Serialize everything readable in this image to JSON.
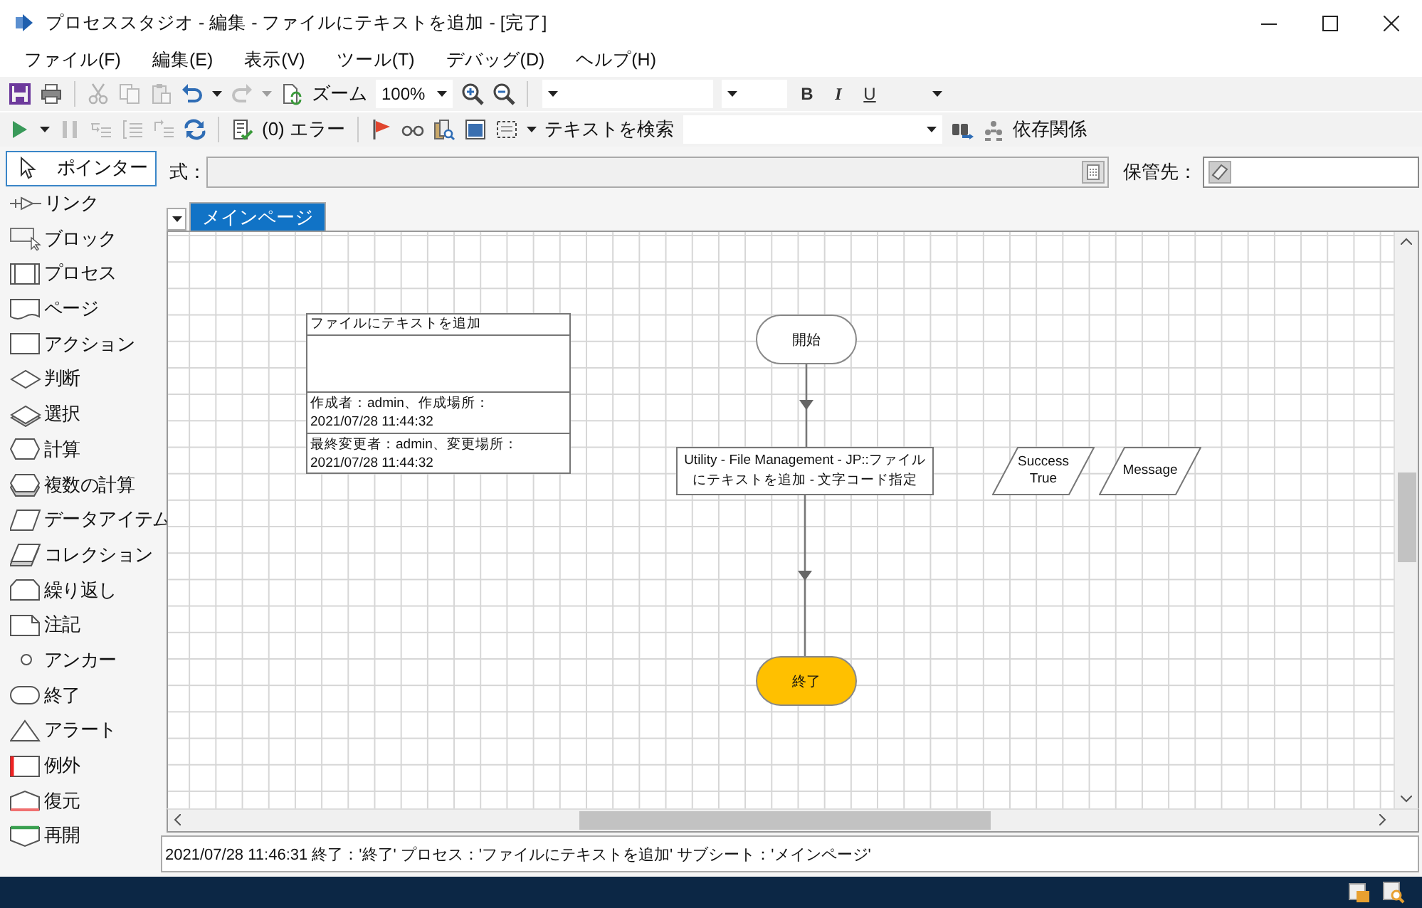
{
  "window": {
    "title": "プロセススタジオ - 編集 - ファイルにテキストを追加 - [完了]"
  },
  "menu": [
    "ファイル(F)",
    "編集(E)",
    "表示(V)",
    "ツール(T)",
    "デバッグ(D)",
    "ヘルプ(H)"
  ],
  "toolbar_1": [
    {
      "kind": "save",
      "disabled": false
    },
    {
      "kind": "print",
      "disabled": false
    },
    {
      "kind": "separator"
    },
    {
      "kind": "cut",
      "disabled": true
    },
    {
      "kind": "copy",
      "disabled": true
    },
    {
      "kind": "paste",
      "disabled": true
    },
    {
      "kind": "undo",
      "disabled": false
    },
    {
      "kind": "caret",
      "disabled": false
    },
    {
      "kind": "redo",
      "disabled": true
    },
    {
      "kind": "caret",
      "disabled": true
    },
    {
      "kind": "page-refresh",
      "disabled": false
    },
    {
      "kind": "label",
      "text": "ズーム"
    },
    {
      "kind": "zoom-combo",
      "value": "100%"
    },
    {
      "kind": "zoom-in",
      "disabled": false
    },
    {
      "kind": "zoom-out",
      "disabled": false
    },
    {
      "kind": "separator"
    },
    {
      "kind": "font-combo"
    },
    {
      "kind": "size-combo"
    },
    {
      "kind": "bold",
      "text": "B"
    },
    {
      "kind": "italic",
      "text": "I"
    },
    {
      "kind": "underline",
      "text": "U"
    },
    {
      "kind": "color-combo"
    }
  ],
  "toolbar_2": [
    {
      "kind": "run",
      "disabled": false
    },
    {
      "kind": "caret",
      "disabled": false
    },
    {
      "kind": "pause",
      "disabled": true
    },
    {
      "kind": "step-into",
      "disabled": true
    },
    {
      "kind": "step-over",
      "disabled": true
    },
    {
      "kind": "step-out",
      "disabled": true
    },
    {
      "kind": "reset",
      "disabled": false
    },
    {
      "kind": "separator"
    },
    {
      "kind": "validate",
      "disabled": false
    },
    {
      "kind": "label",
      "text": "(0) エラー"
    },
    {
      "kind": "separator"
    },
    {
      "kind": "breakpoint",
      "disabled": false
    },
    {
      "kind": "watch",
      "disabled": false
    },
    {
      "kind": "find-references",
      "disabled": false
    },
    {
      "kind": "full-screen",
      "disabled": false
    },
    {
      "kind": "select-area",
      "disabled": false
    },
    {
      "kind": "caret",
      "disabled": false
    },
    {
      "kind": "label",
      "text": "テキストを検索"
    },
    {
      "kind": "search-combo"
    },
    {
      "kind": "find",
      "disabled": false
    },
    {
      "kind": "dependencies",
      "disabled": false
    },
    {
      "kind": "label",
      "text": "依存関係"
    }
  ],
  "palette": [
    {
      "kind": "pointer",
      "label": "ポインター",
      "selected": true
    },
    {
      "kind": "link",
      "label": "リンク",
      "selected": false
    },
    {
      "kind": "block",
      "label": "ブロック",
      "selected": false
    },
    {
      "kind": "process",
      "label": "プロセス",
      "selected": false
    },
    {
      "kind": "page",
      "label": "ページ",
      "selected": false
    },
    {
      "kind": "action",
      "label": "アクション",
      "selected": false
    },
    {
      "kind": "decision",
      "label": "判断",
      "selected": false
    },
    {
      "kind": "choice",
      "label": "選択",
      "selected": false
    },
    {
      "kind": "calculation",
      "label": "計算",
      "selected": false
    },
    {
      "kind": "multi-calculation",
      "label": "複数の計算",
      "selected": false
    },
    {
      "kind": "data-item",
      "label": "データアイテム",
      "selected": false
    },
    {
      "kind": "collection",
      "label": "コレクション",
      "selected": false
    },
    {
      "kind": "loop",
      "label": "繰り返し",
      "selected": false
    },
    {
      "kind": "note",
      "label": "注記",
      "selected": false
    },
    {
      "kind": "anchor",
      "label": "アンカー",
      "selected": false
    },
    {
      "kind": "end",
      "label": "終了",
      "selected": false
    },
    {
      "kind": "alert",
      "label": "アラート",
      "selected": false
    },
    {
      "kind": "exception",
      "label": "例外",
      "selected": false
    },
    {
      "kind": "recover",
      "label": "復元",
      "selected": false
    },
    {
      "kind": "resume",
      "label": "再開",
      "selected": false
    }
  ],
  "formula": {
    "label": "式："
  },
  "store": {
    "label": "保管先："
  },
  "tabs": [
    {
      "label": "メインページ",
      "selected": true
    }
  ],
  "canvas": {
    "nodes": [
      {
        "kind": "info",
        "title": "ファイルにテキストを追加",
        "created": [
          "作成者：admin、作成場所：",
          "2021/07/28 11:44:32"
        ],
        "modified": [
          "最終変更者：admin、変更場所：",
          "2021/07/28 11:44:32"
        ]
      },
      {
        "kind": "start",
        "label": "開始"
      },
      {
        "kind": "action",
        "label": "Utility - File Management - JP::ファイルにテキストを追加 - 文字コード指定"
      },
      {
        "kind": "end",
        "label": "終了"
      },
      {
        "kind": "data",
        "name": "Success",
        "value": "True"
      },
      {
        "kind": "data",
        "name": "Message"
      }
    ]
  },
  "status_bar": {
    "text": "2021/07/28 11:46:31 終了：'終了' プロセス：'ファイルにテキストを追加' サブシート：'メインページ'"
  }
}
